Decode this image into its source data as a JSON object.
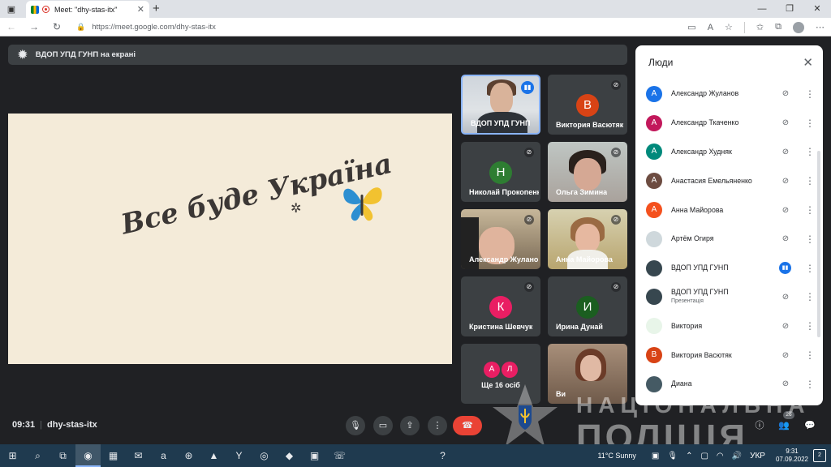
{
  "browser": {
    "tab_title": "Meet: \"dhy-stas-itx\"",
    "url": "https://meet.google.com/dhy-stas-itx",
    "tab_close": "✕",
    "new_tab": "+"
  },
  "meet": {
    "presenter_banner": "ВДОП УПД ГУНП на екрані",
    "slide_text": "Все буде Україна",
    "tiles": [
      {
        "name": "ВДОП УПД ГУНП"
      },
      {
        "name": "Виктория Васютяк",
        "initial": "В"
      },
      {
        "name": "Николай Прокопенко",
        "initial": "Н"
      },
      {
        "name": "Ольга Зимина"
      },
      {
        "name": "Александр Жуланов"
      },
      {
        "name": "Анна Майорова"
      },
      {
        "name": "Кристина Шевчук",
        "initial": "К"
      },
      {
        "name": "Ирина Дунай",
        "initial": "И"
      },
      {
        "name": "Ще 16 осіб",
        "initials": [
          "А",
          "Л"
        ]
      },
      {
        "name": "Ви"
      }
    ],
    "meeting_time": "09:31",
    "meeting_code": "dhy-stas-itx",
    "people_count": "26"
  },
  "people_panel": {
    "title": "Люди",
    "people": [
      {
        "name": "Александр Жуланов",
        "initial": "А",
        "color": "#1a73e8"
      },
      {
        "name": "Александр Ткаченко",
        "initial": "А",
        "color": "#c2185b"
      },
      {
        "name": "Александр Худняк",
        "initial": "А",
        "color": "#00897b"
      },
      {
        "name": "Анастасия Емельяненко",
        "initial": "А",
        "color": "#6d4c41"
      },
      {
        "name": "Анна Майорова",
        "initial": "А",
        "color": "#f4511e"
      },
      {
        "name": "Артём Огиря",
        "initial": "",
        "color": "#cfd8dc"
      },
      {
        "name": "ВДОП УПД ГУНП",
        "initial": "",
        "color": "#37474f"
      },
      {
        "name": "ВДОП УПД ГУНП",
        "sub": "Презентація",
        "initial": "",
        "color": "#37474f"
      },
      {
        "name": "Виктория",
        "initial": "",
        "color": "#e8f5e9"
      },
      {
        "name": "Виктория Васютяк",
        "initial": "В",
        "color": "#d84315"
      },
      {
        "name": "Диана",
        "initial": "",
        "color": "#455a64"
      }
    ]
  },
  "watermark": {
    "line1": "НАЦІОНАЛЬНА",
    "line2": "ПОЛІЦІЯ"
  },
  "taskbar": {
    "weather": "11°C  Sunny",
    "lang": "УКР",
    "time": "9:31",
    "date": "07.09.2022",
    "notif_count": "2"
  }
}
